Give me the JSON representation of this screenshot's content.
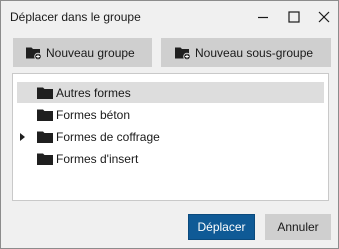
{
  "window": {
    "title": "Déplacer dans le groupe",
    "controls": [
      "minimize-icon",
      "maximize-icon",
      "close-icon"
    ]
  },
  "toolbar": {
    "new_group_label": "Nouveau groupe",
    "new_group_icon": "folder-add-icon",
    "new_subgroup_label": "Nouveau sous-groupe",
    "new_subgroup_icon": "folder-add-icon"
  },
  "tree": {
    "items": [
      {
        "label": "Autres formes",
        "selected": true,
        "expandable": false
      },
      {
        "label": "Formes béton",
        "selected": false,
        "expandable": false
      },
      {
        "label": "Formes de coffrage",
        "selected": false,
        "expandable": true
      },
      {
        "label": "Formes d'insert",
        "selected": false,
        "expandable": false
      }
    ]
  },
  "footer": {
    "ok_label": "Déplacer",
    "cancel_label": "Annuler"
  },
  "colors": {
    "primary_button": "#0f5a96",
    "selection": "#dddddd",
    "folder": "#1f1f1f"
  }
}
